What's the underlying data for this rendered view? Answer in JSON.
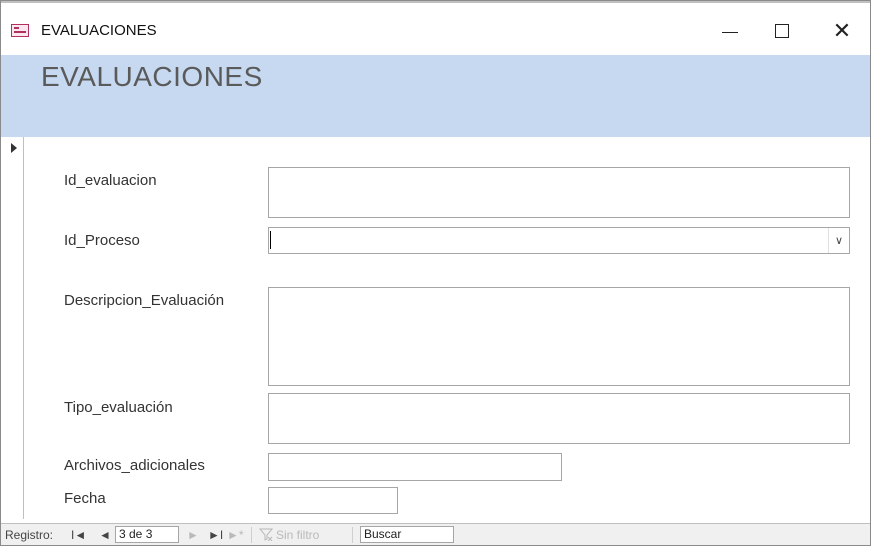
{
  "window": {
    "title": "EVALUACIONES",
    "minimize_glyph": "—",
    "maximize_glyph": "☐",
    "close_glyph": "✕"
  },
  "form": {
    "heading": "EVALUACIONES",
    "fields": {
      "id_evaluacion": {
        "label": "Id_evaluacion",
        "value": ""
      },
      "id_proceso": {
        "label": "Id_Proceso",
        "value": ""
      },
      "descripcion": {
        "label": "Descripcion_Evaluación",
        "value": ""
      },
      "tipo": {
        "label": "Tipo_evaluación",
        "value": ""
      },
      "archivos": {
        "label": "Archivos_adicionales",
        "value": ""
      },
      "fecha": {
        "label": "Fecha",
        "value": ""
      }
    }
  },
  "navigation": {
    "label": "Registro:",
    "first": "I◄",
    "prev": "◄",
    "current_record": "3 de 3",
    "next": "►",
    "last": "►I",
    "new": "►*",
    "filter_icon": "filter-icon",
    "filter_label": "Sin filtro",
    "search_label": "Buscar"
  },
  "colors": {
    "header_band": "#c7d9f1",
    "heading_text": "#5a5a5a"
  }
}
